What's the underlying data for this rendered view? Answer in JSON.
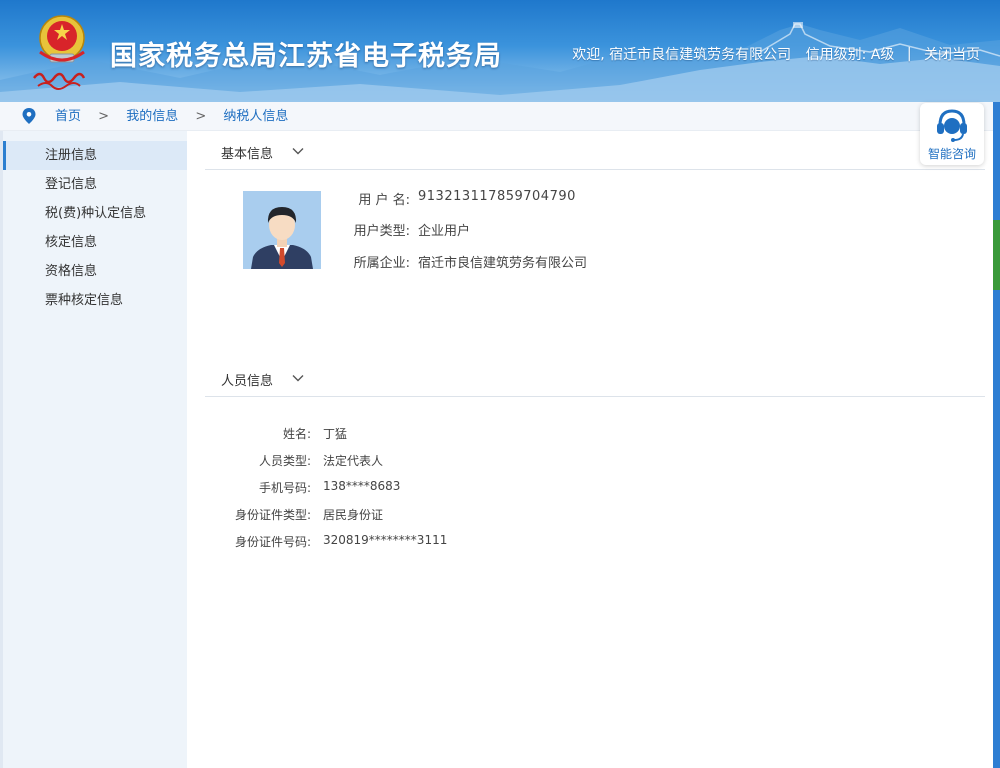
{
  "header": {
    "title": "国家税务总局江苏省电子税务局",
    "welcome": "欢迎, 宿迁市良信建筑劳务有限公司",
    "credit_label": "信用级别:",
    "credit_value": "A级",
    "separator": "|",
    "close_label": "关闭当页"
  },
  "breadcrumb": {
    "items": [
      "首页",
      "我的信息",
      "纳税人信息"
    ],
    "separator": ">"
  },
  "sidebar": {
    "items": [
      {
        "label": "注册信息",
        "active": true
      },
      {
        "label": "登记信息"
      },
      {
        "label": "税(费)种认定信息"
      },
      {
        "label": "核定信息"
      },
      {
        "label": "资格信息"
      },
      {
        "label": "票种核定信息"
      }
    ]
  },
  "basic_info": {
    "title": "基本信息",
    "fields": [
      {
        "label": "用 户 名:",
        "value": "913213117859704790"
      },
      {
        "label": "用户类型:",
        "value": "企业用户"
      },
      {
        "label": "所属企业:",
        "value": "宿迁市良信建筑劳务有限公司"
      }
    ]
  },
  "person_info": {
    "title": "人员信息",
    "fields": [
      {
        "label": "姓名:",
        "value": "丁猛"
      },
      {
        "label": "人员类型:",
        "value": "法定代表人"
      },
      {
        "label": "手机号码:",
        "value": "138****8683"
      },
      {
        "label": "身份证件类型:",
        "value": "居民身份证"
      },
      {
        "label": "身份证件号码:",
        "value": "320819********3111"
      }
    ]
  },
  "assistant": {
    "label": "智能咨询"
  },
  "colors": {
    "brand_blue": "#1f6fc1",
    "header_blue": "#1f78cc",
    "sidebar_bg": "#eef4fa",
    "avatar_bg": "#a9cdee"
  },
  "icons": {
    "breadcrumb": "location-pin-icon",
    "section_toggle": "chevron-down-icon",
    "assistant": "headset-icon",
    "avatar": "user-avatar-icon",
    "emblem": "tax-emblem-icon"
  }
}
